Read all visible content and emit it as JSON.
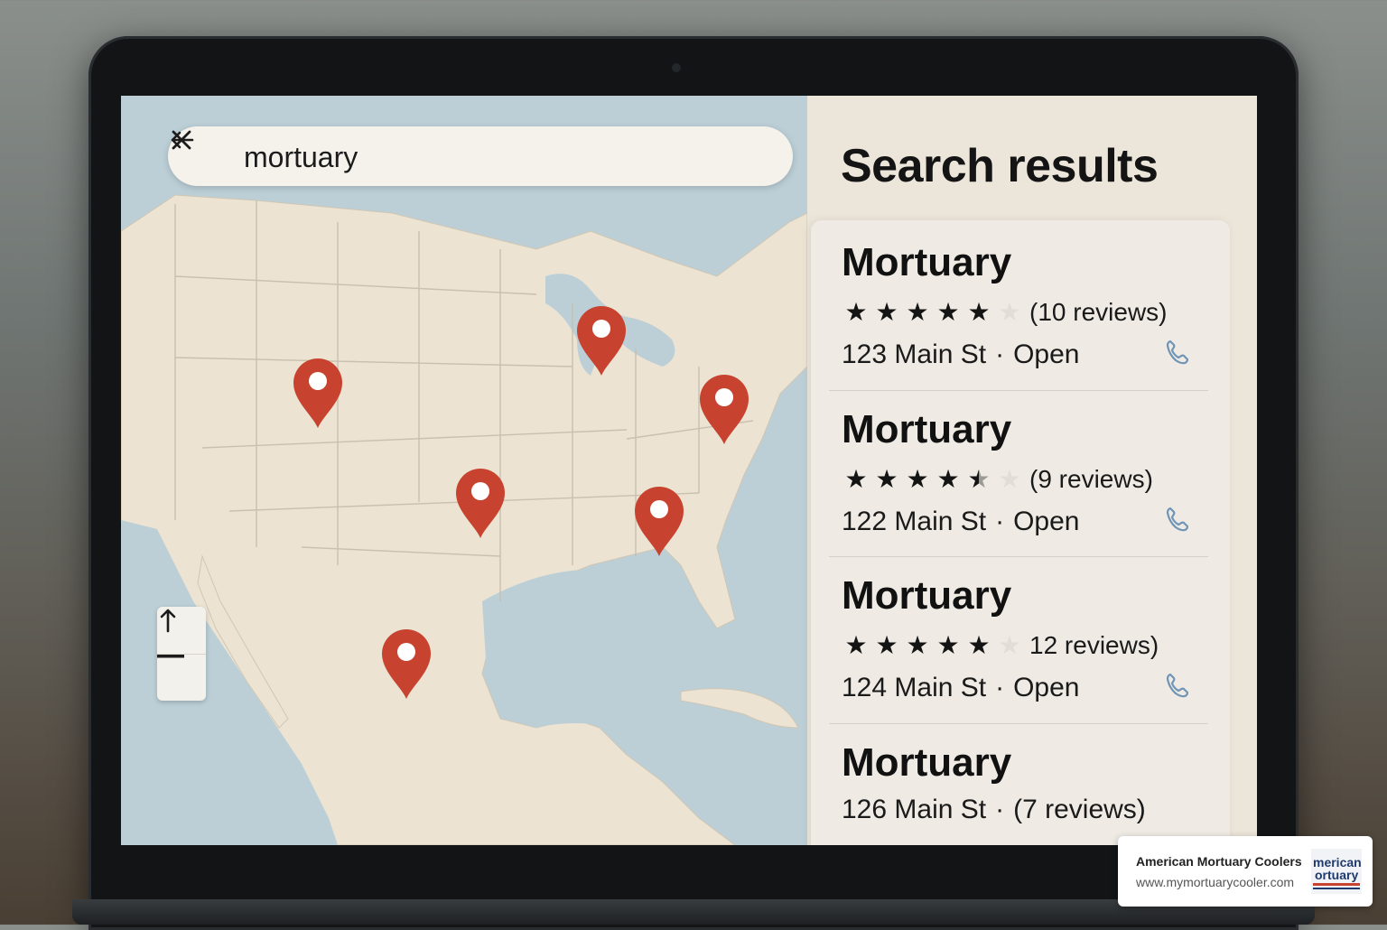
{
  "search": {
    "query": "mortuary",
    "back_icon": "arrow-left-icon",
    "clear_icon": "close-icon"
  },
  "map": {
    "pin_color": "#c8432f",
    "land_color": "#ece3d2",
    "water_color": "#bccfd7",
    "pin_count": 6
  },
  "zoom": {
    "up_icon": "arrow-up-icon",
    "minus_icon": "minus-icon"
  },
  "panel": {
    "title": "Search results"
  },
  "results": [
    {
      "name": "Mortuary",
      "rating": 5,
      "reviews": "(10 reviews)",
      "address": "123 Main St",
      "status": "Open"
    },
    {
      "name": "Mortuary",
      "rating": 4.5,
      "reviews": "(9 reviews)",
      "address": "122 Main St",
      "status": "Open"
    },
    {
      "name": "Mortuary",
      "rating": 5,
      "reviews": "12 reviews)",
      "address": "124 Main St",
      "status": "Open"
    },
    {
      "name": "Mortuary",
      "address": "126 Main St",
      "reviews": "(7 reviews)"
    }
  ],
  "separator": "·",
  "watermark": {
    "name": "American Mortuary Coolers",
    "url": "www.mymortuarycooler.com",
    "logo_text_1": "merican",
    "logo_text_2": "ortuary"
  }
}
